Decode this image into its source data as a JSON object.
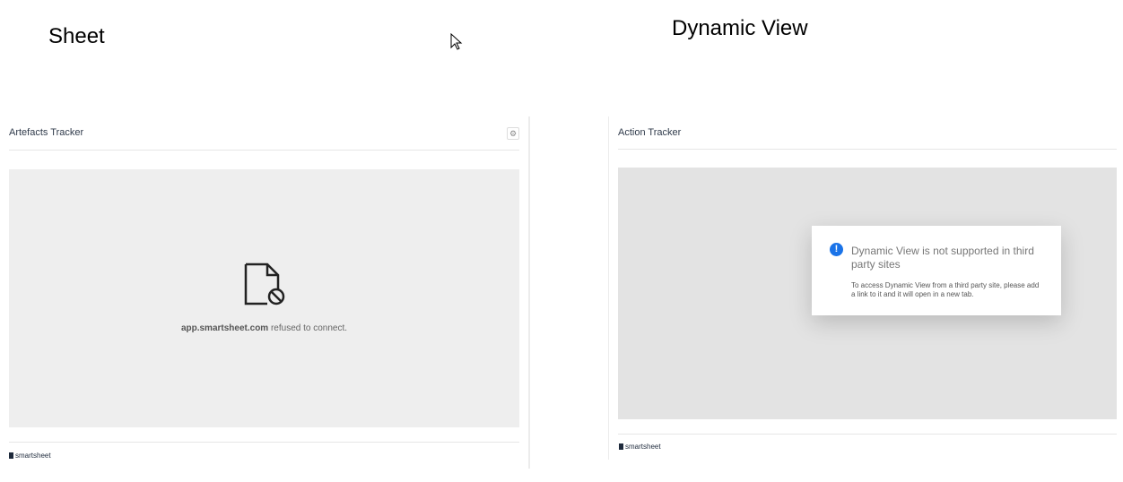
{
  "labels": {
    "left": "Sheet",
    "right": "Dynamic View"
  },
  "left_panel": {
    "title": "Artefacts Tracker",
    "error_host": "app.smartsheet.com",
    "error_text": " refused to connect.",
    "footer": "smartsheet"
  },
  "right_panel": {
    "title": "Action Tracker",
    "dialog_title": "Dynamic View is not supported in third party sites",
    "dialog_body": "To access Dynamic View from a third party site, please add a link to it and it will open in a new tab.",
    "footer": "smartsheet"
  },
  "colors": {
    "info": "#1a73e8"
  }
}
